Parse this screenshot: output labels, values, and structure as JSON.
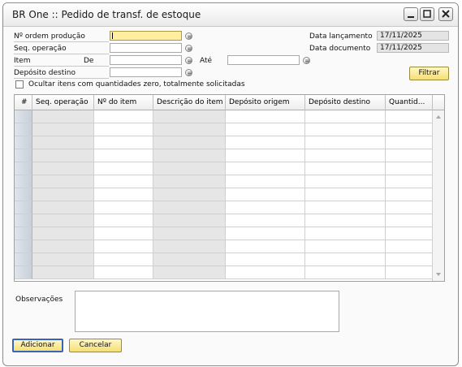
{
  "window": {
    "title": "BR One :: Pedido de transf. de estoque"
  },
  "form": {
    "ordem_label": "Nº ordem produção",
    "seq_label": "Seq. operação",
    "item_label": "Item",
    "de_label": "De",
    "ate_label": "Até",
    "deposito_label": "Depósito destino",
    "ocultar_label": "Ocultar itens com quantidades zero, totalmente solicitadas",
    "data_lancamento_label": "Data lançamento",
    "data_lancamento_value": "17/11/2025",
    "data_documento_label": "Data documento",
    "data_documento_value": "17/11/2025",
    "filtrar_label": "Filtrar"
  },
  "grid": {
    "columns": [
      "#",
      "Seq. operação",
      "Nº do item",
      "Descrição do item",
      "Depósito origem",
      "Depósito destino",
      "Quantid..."
    ],
    "rows": 13
  },
  "footer": {
    "observacoes_label": "Observações",
    "adicionar_label": "Adicionar",
    "cancelar_label": "Cancelar"
  }
}
